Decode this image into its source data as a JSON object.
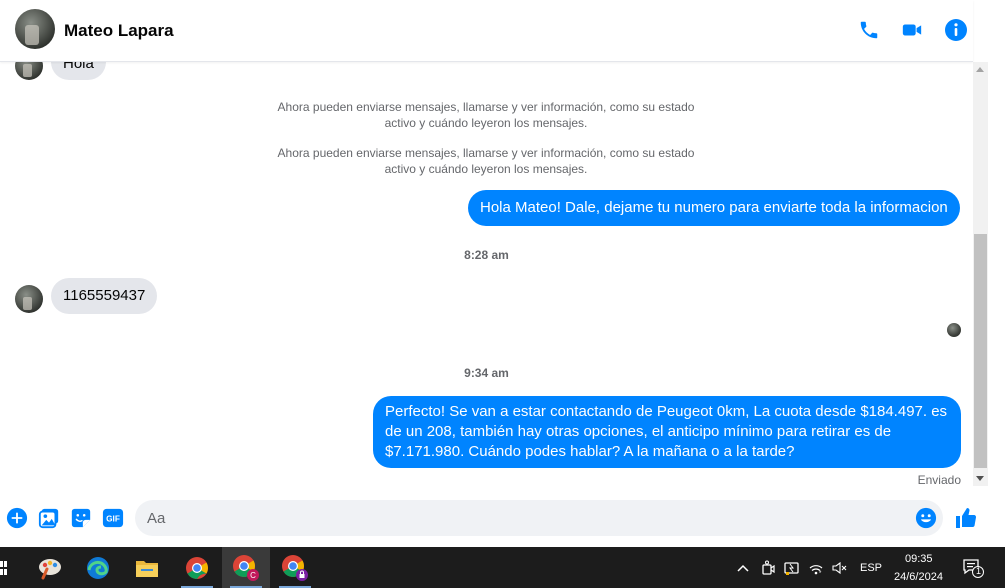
{
  "contact": {
    "name": "Mateo Lapara"
  },
  "header_icons": [
    "phone-icon",
    "video-icon",
    "info-icon"
  ],
  "messages": {
    "first_in": "Hola",
    "system_1": "Ahora pueden enviarse mensajes, llamarse y ver información, como su estado activo y cuándo leyeron los mensajes.",
    "system_2": "Ahora pueden enviarse mensajes, llamarse y ver información, como su estado activo y cuándo leyeron los mensajes.",
    "out_1": "Hola Mateo! Dale, dejame tu numero para enviarte toda la informacion",
    "time_1": "8:28 am",
    "in_2": "1165559437",
    "time_2": "9:34 am",
    "out_2": "Perfecto!  Se van a estar contactando de Peugeot 0km, La cuota desde $184.497. es de un 208, también hay otras opciones, el anticipo mínimo para retirar es de $7.171.980. Cuándo podes hablar? A la mañana o a la tarde?",
    "status": "Enviado"
  },
  "composer": {
    "placeholder": "Aa",
    "value": ""
  },
  "composer_icons": [
    "plus-icon",
    "gallery-icon",
    "sticker-icon",
    "gif-icon",
    "emoji-icon",
    "like-icon"
  ],
  "gif_label": "GIF",
  "colors": {
    "accent": "#0084ff",
    "incoming": "#e4e6eb",
    "taskbar": "#1c1c1c"
  },
  "taskbar": {
    "language": "ESP",
    "time": "09:35",
    "date": "24/6/2024",
    "notifications": "1",
    "apps": [
      "paint-app-icon",
      "edge-icon",
      "file-explorer-icon",
      "chrome-icon",
      "chrome-profile-c-icon",
      "chrome-profile-lock-icon"
    ],
    "chrome_profile_letter": "C"
  }
}
